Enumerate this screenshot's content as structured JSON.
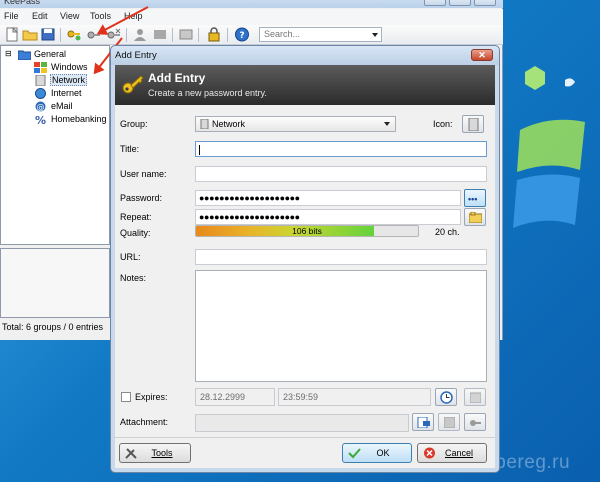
{
  "desktop": {
    "watermark": "webereg.ru"
  },
  "main_window": {
    "menu": [
      "File",
      "Edit",
      "View",
      "Tools",
      "Help"
    ],
    "search_placeholder": "Search...",
    "tree": {
      "root": "General",
      "items": [
        "Windows",
        "Network",
        "Internet",
        "eMail",
        "Homebanking"
      ],
      "selected": "Network"
    },
    "status": "Total: 6 groups / 0 entries"
  },
  "dialog": {
    "title": "Add Entry",
    "banner": {
      "title": "Add Entry",
      "subtitle": "Create a new password entry."
    },
    "labels": {
      "group": "Group:",
      "icon": "Icon:",
      "title": "Title:",
      "username": "User name:",
      "password": "Password:",
      "repeat": "Repeat:",
      "quality": "Quality:",
      "url": "URL:",
      "notes": "Notes:",
      "expires": "Expires:",
      "attachment": "Attachment:"
    },
    "group_value": "Network",
    "title_value": "",
    "username_value": "",
    "password_masked": "●●●●●●●●●●●●●●●●●●●●",
    "repeat_masked": "●●●●●●●●●●●●●●●●●●●●",
    "show_password_glyph": "•••",
    "quality": {
      "bits_text": "106 bits",
      "level": 0.8,
      "chars_text": "20 ch."
    },
    "url_value": "",
    "notes_value": "",
    "expires": {
      "checked": false,
      "date": "28.12.2999",
      "time": "23:59:59"
    },
    "buttons": {
      "tools": "Tools",
      "ok": "OK",
      "cancel": "Cancel"
    },
    "close_glyph": "✕"
  },
  "colors": {
    "annotation_arrow": "#e0321b",
    "banner": "#3a3a3a",
    "ok_border": "#3c7fb1"
  }
}
